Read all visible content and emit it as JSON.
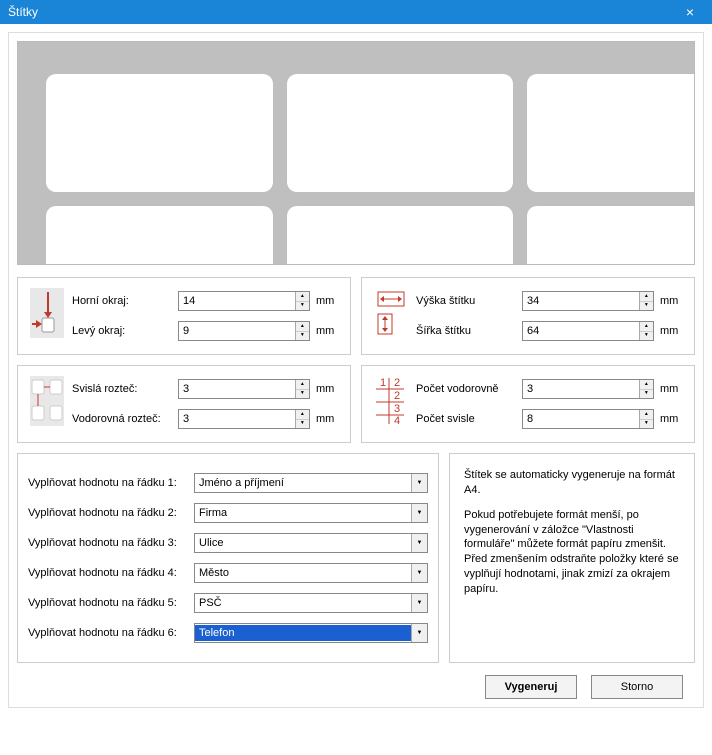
{
  "window": {
    "title": "Štítky",
    "close": "×"
  },
  "margins": {
    "top_label": "Horní okraj:",
    "top_value": "14",
    "left_label": "Levý okraj:",
    "left_value": "9",
    "unit": "mm"
  },
  "size": {
    "height_label": "Výška štítku",
    "height_value": "34",
    "width_label": "Šířka štítku",
    "width_value": "64",
    "unit": "mm"
  },
  "spacing": {
    "vertical_label": "Svislá rozteč:",
    "vertical_value": "3",
    "horizontal_label": "Vodorovná rozteč:",
    "horizontal_value": "3",
    "unit": "mm"
  },
  "count": {
    "across_label": "Počet vodorovně",
    "across_value": "3",
    "down_label": "Počet svisle",
    "down_value": "8",
    "unit": "mm"
  },
  "rows": {
    "label_prefix": "Vyplňovat hodnotu na řádku",
    "items": [
      {
        "label": "Vyplňovat hodnotu na řádku 1:",
        "value": "Jméno a příjmení"
      },
      {
        "label": "Vyplňovat hodnotu na řádku 2:",
        "value": "Firma"
      },
      {
        "label": "Vyplňovat hodnotu na řádku 3:",
        "value": "Ulice"
      },
      {
        "label": "Vyplňovat hodnotu na řádku 4:",
        "value": "Město"
      },
      {
        "label": "Vyplňovat hodnotu na řádku 5:",
        "value": "PSČ"
      },
      {
        "label": "Vyplňovat hodnotu na řádku 6:",
        "value": "Telefon"
      }
    ],
    "selected_index": 5
  },
  "info": {
    "p1": "Štítek se automaticky vygeneruje na formát A4.",
    "p2": "Pokud potřebujete formát menší, po vygenerování v záložce \"Vlastnosti formuláře\" můžete formát papíru zmenšit. Před zmenšením odstraňte položky které se vyplňují hodnotami, jinak zmizí za okrajem papíru."
  },
  "buttons": {
    "generate": "Vygeneruj",
    "cancel": "Storno"
  }
}
